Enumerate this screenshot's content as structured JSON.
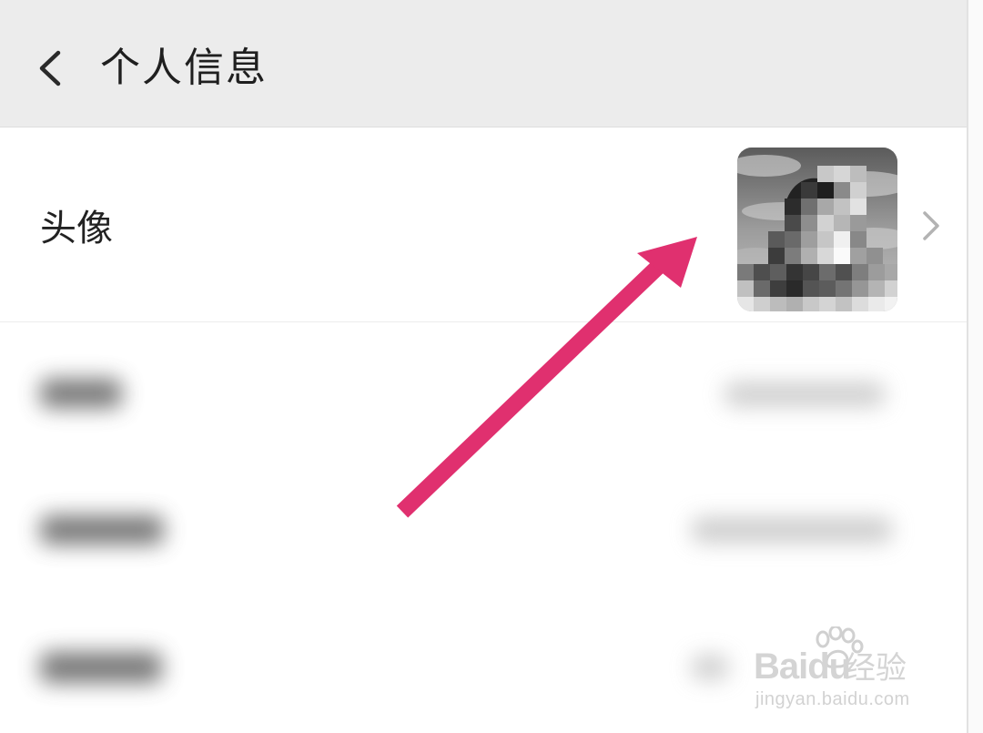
{
  "header": {
    "back_icon": "chevron-left-icon",
    "title": "个人信息"
  },
  "avatar_row": {
    "label": "头像",
    "avatar_state": "pixelated",
    "chevron_icon": "chevron-right-icon"
  },
  "annotation": {
    "arrow_color": "#e0306f"
  },
  "watermark": {
    "brand": "Baidu",
    "brand_cn": "经验",
    "url": "jingyan.baidu.com"
  },
  "colors": {
    "header_bg": "#ececec",
    "page_bg": "#ffffff",
    "title_text": "#1f1f1f",
    "chevron": "#b3b3b3"
  }
}
